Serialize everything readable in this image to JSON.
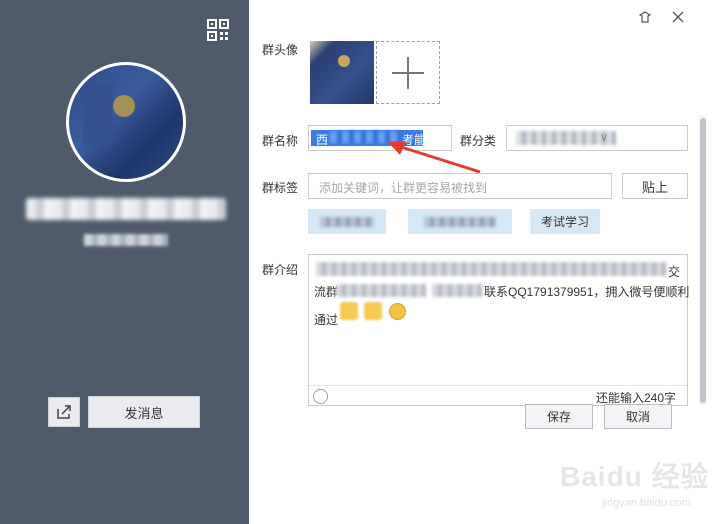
{
  "window": {
    "skin_icon": "skin-icon",
    "close_icon": "close-icon"
  },
  "left_panel": {
    "qr_icon": "qr-code-icon",
    "send_label": "发消息",
    "share_icon": "share-icon"
  },
  "form": {
    "avatar_label": "群头像",
    "name_label": "群名称",
    "name_value_head": "西",
    "name_value_tail": "考能",
    "category_label": "群分类",
    "tags_label": "群标签",
    "tags_placeholder": "添加关键词，让群更容易被找到",
    "paste_label": "贴上",
    "tag_chips": [
      "",
      "",
      "考试学习"
    ],
    "intro_label": "群介绍",
    "intro_line1_tail": "交",
    "intro_line2_head": "流群",
    "intro_line2_tail": "联系QQ1791379951，拥入微号便顺利",
    "intro_line3": "通过",
    "remaining": "还能输入240字"
  },
  "actions": {
    "save": "保存",
    "cancel": "取消"
  },
  "watermark": {
    "brand": "Baidu 经验",
    "url": "jingyan.baidu.com"
  }
}
